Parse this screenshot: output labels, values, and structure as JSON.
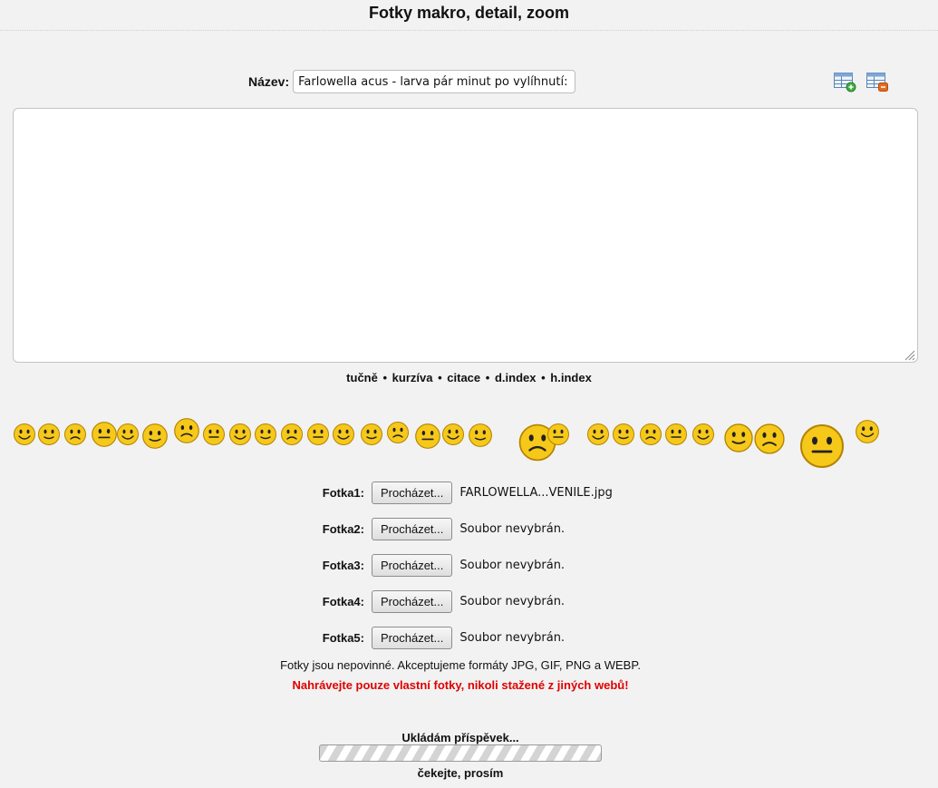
{
  "page_title": "Fotky makro, detail, zoom",
  "title_field": {
    "label": "Název:",
    "value": "Farlowella acus - larva pár minut po vylíhnutí:"
  },
  "toolbar": {
    "icons": [
      "insert-table-icon",
      "delete-table-icon"
    ]
  },
  "message": {
    "value": ""
  },
  "format_links": [
    "tučně",
    "kurzíva",
    "citace",
    "d.index",
    "h.index"
  ],
  "format_separator": "•",
  "smileys": [
    "smile",
    "wink",
    "crying",
    "music",
    "thinking",
    "glasses",
    "grin",
    "talking",
    "laughing",
    "tongue",
    "dizzy",
    "happy",
    "sly",
    "thumbs-up",
    "rolling-eyes",
    "surprised",
    "sleeping",
    "angry",
    "big-eyes",
    "doh",
    "chuckle",
    "sad",
    "smirk",
    "kiss",
    "bye",
    "drummer",
    "cheers",
    "cheers-2",
    "jumping"
  ],
  "files": [
    {
      "label": "Fotka1:",
      "button": "Procházet...",
      "status": "FARLOWELLA...VENILE.jpg"
    },
    {
      "label": "Fotka2:",
      "button": "Procházet...",
      "status": "Soubor nevybrán."
    },
    {
      "label": "Fotka3:",
      "button": "Procházet...",
      "status": "Soubor nevybrán."
    },
    {
      "label": "Fotka4:",
      "button": "Procházet...",
      "status": "Soubor nevybrán."
    },
    {
      "label": "Fotka5:",
      "button": "Procházet...",
      "status": "Soubor nevybrán."
    }
  ],
  "info_text": "Fotky jsou nepovinné. Akceptujeme formáty JPG, GIF, PNG a WEBP.",
  "warning_text": "Nahrávejte pouze vlastní fotky, nikoli stažené z jiných webů!",
  "saving": {
    "label": "Ukládám příspěvek...",
    "wait": "čekejte, prosím"
  },
  "colors": {
    "warning": "#e00000",
    "smiley": "#f6c81a",
    "smiley_outline": "#b38300",
    "background": "#f2f2f2"
  }
}
